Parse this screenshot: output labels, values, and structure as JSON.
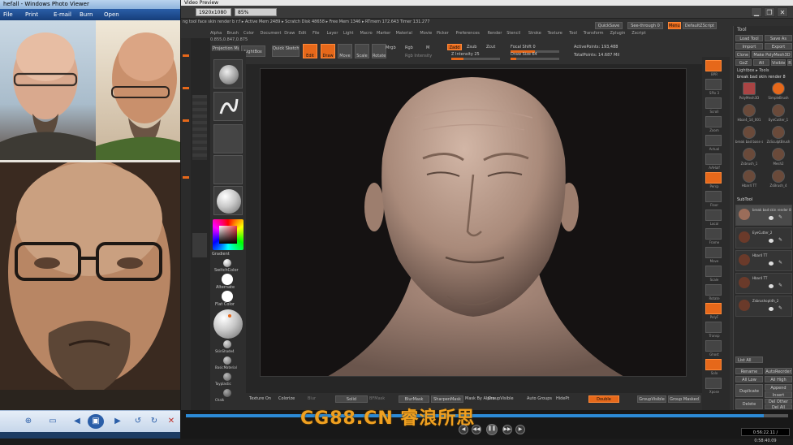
{
  "photo_viewer": {
    "title": "hefall - Windows Photo Viewer",
    "menu": {
      "file": "File",
      "print": "Print",
      "email": "E-mail",
      "burn": "Burn",
      "open": "Open"
    }
  },
  "video": {
    "title": "Video Preview",
    "resolution": "1920x1080",
    "zoom": "85%",
    "timecode": "0:56:22.11 / 0:58:40.09",
    "progress": 0.96,
    "watermark": "CG88.CN 睿浪所思"
  },
  "zbrush": {
    "top_info": "ng tool face skin render b r:f  ▸ Active Mem 2489 ▸ Scratch Disk 48658 ▸ Free Mem 1346 ▸ RTmem 172.643 Timer 131.277",
    "menus": [
      "Alpha",
      "Brush",
      "Color",
      "Document",
      "Draw",
      "Edit",
      "File",
      "Layer",
      "Light",
      "Macro",
      "Marker",
      "Material",
      "Movie",
      "Picker",
      "Preferences",
      "Render",
      "Stencil",
      "Stroke",
      "Texture",
      "Tool",
      "Transform",
      "Zplugin",
      "Zscript"
    ],
    "coords": "0.855,0.847,0.875",
    "buttons": {
      "projection_master": "Projection Master",
      "lightbox": "LightBox",
      "quick_sketch": "Quick Sketch",
      "edit": "Edit",
      "draw": "Draw",
      "move": "Move",
      "scale": "Scale",
      "rotate": "Rotate",
      "mrgb": "Mrgb",
      "rgb": "Rgb",
      "m": "M",
      "zadd": "Zadd",
      "zsub": "Zsub",
      "zcut": "Zcut",
      "quicksave": "QuickSave",
      "see_through": "See-through  0",
      "menus": "Menus",
      "default_zscript": "DefaultZScript"
    },
    "sliders": {
      "z_intensity": "Z Intensity 25",
      "rgb_intensity": "Rgb Intensity",
      "focal_shift": "Focal Shift 0",
      "draw_size": "Draw Size 64",
      "active_points": "ActivePoints: 193,488",
      "total_points": "TotalPoints: 14.687 Mil"
    },
    "left_panel": {
      "gradient": "Gradient",
      "switch_color": "SwitchColor",
      "alternate": "Alternate",
      "flat_color": "Flat Color",
      "material_labels": [
        "SkinShade4",
        "BasicMaterial",
        "Toyplastic",
        "Chalk"
      ]
    },
    "right_shelf": [
      "BPR",
      "SPix 3",
      "Scroll",
      "Zoom",
      "Actual",
      "AAHalf",
      "Persp",
      "Floor",
      "Local",
      "Frame",
      "Move",
      "Scale",
      "Rotate",
      "PolyF",
      "Transp",
      "Ghost",
      "Solo",
      "Xpose"
    ],
    "tool_panel": {
      "header": "Tool",
      "load_tool": "Load Tool",
      "save_as": "Save As",
      "import": "Import",
      "export": "Export",
      "clone": "Clone",
      "make_polymesh": "Make PolyMesh3D",
      "goz": "GoZ",
      "all": "All",
      "visible": "Visible",
      "r": "R",
      "lightbox_tools": "Lightbox ▸ Tools",
      "current_tool": "break bad skin render 8",
      "tools": [
        "PolyMesh3D",
        "SimpleBrush",
        "Hbar4_14_001",
        "EyeCutter_1",
        "break bad base sk",
        "ZsSculptBrush",
        "Zsbrush_1",
        "Mesh2",
        "Hbar4 TT",
        "ZsBrush_4"
      ],
      "subtool": "SubTool",
      "subtools": [
        "break bad skin render 8",
        "EyeCutter_2",
        "Hbar4 TT",
        "Hbar4 TT",
        "Zsbrushopt4h_2"
      ],
      "list_all": "List All",
      "rename": "Rename",
      "auto_reorder": "AutoReorder",
      "all_low": "All Low",
      "all_high": "All High",
      "duplicate": "Duplicate",
      "append": "Append",
      "insert": "Insert",
      "delete": "Delete",
      "del_other": "Del Other",
      "del_all": "Del All"
    },
    "bottom": {
      "texture_on": "Texture On",
      "colorize": "Colorize",
      "blur": "Blur",
      "solid": "Solid",
      "backfacemask": "BFMask",
      "blur_mask": "BlurMask",
      "sharpen_mask": "SharpenMask",
      "mask_by_alpha": "Mask By Alpha",
      "group_visible": "GroupVisible",
      "auto_groups": "Auto Groups",
      "hide_pt": "HidePt",
      "double": "Double",
      "group_visible2": "GroupVisible",
      "group_masked": "Group Masked"
    }
  }
}
